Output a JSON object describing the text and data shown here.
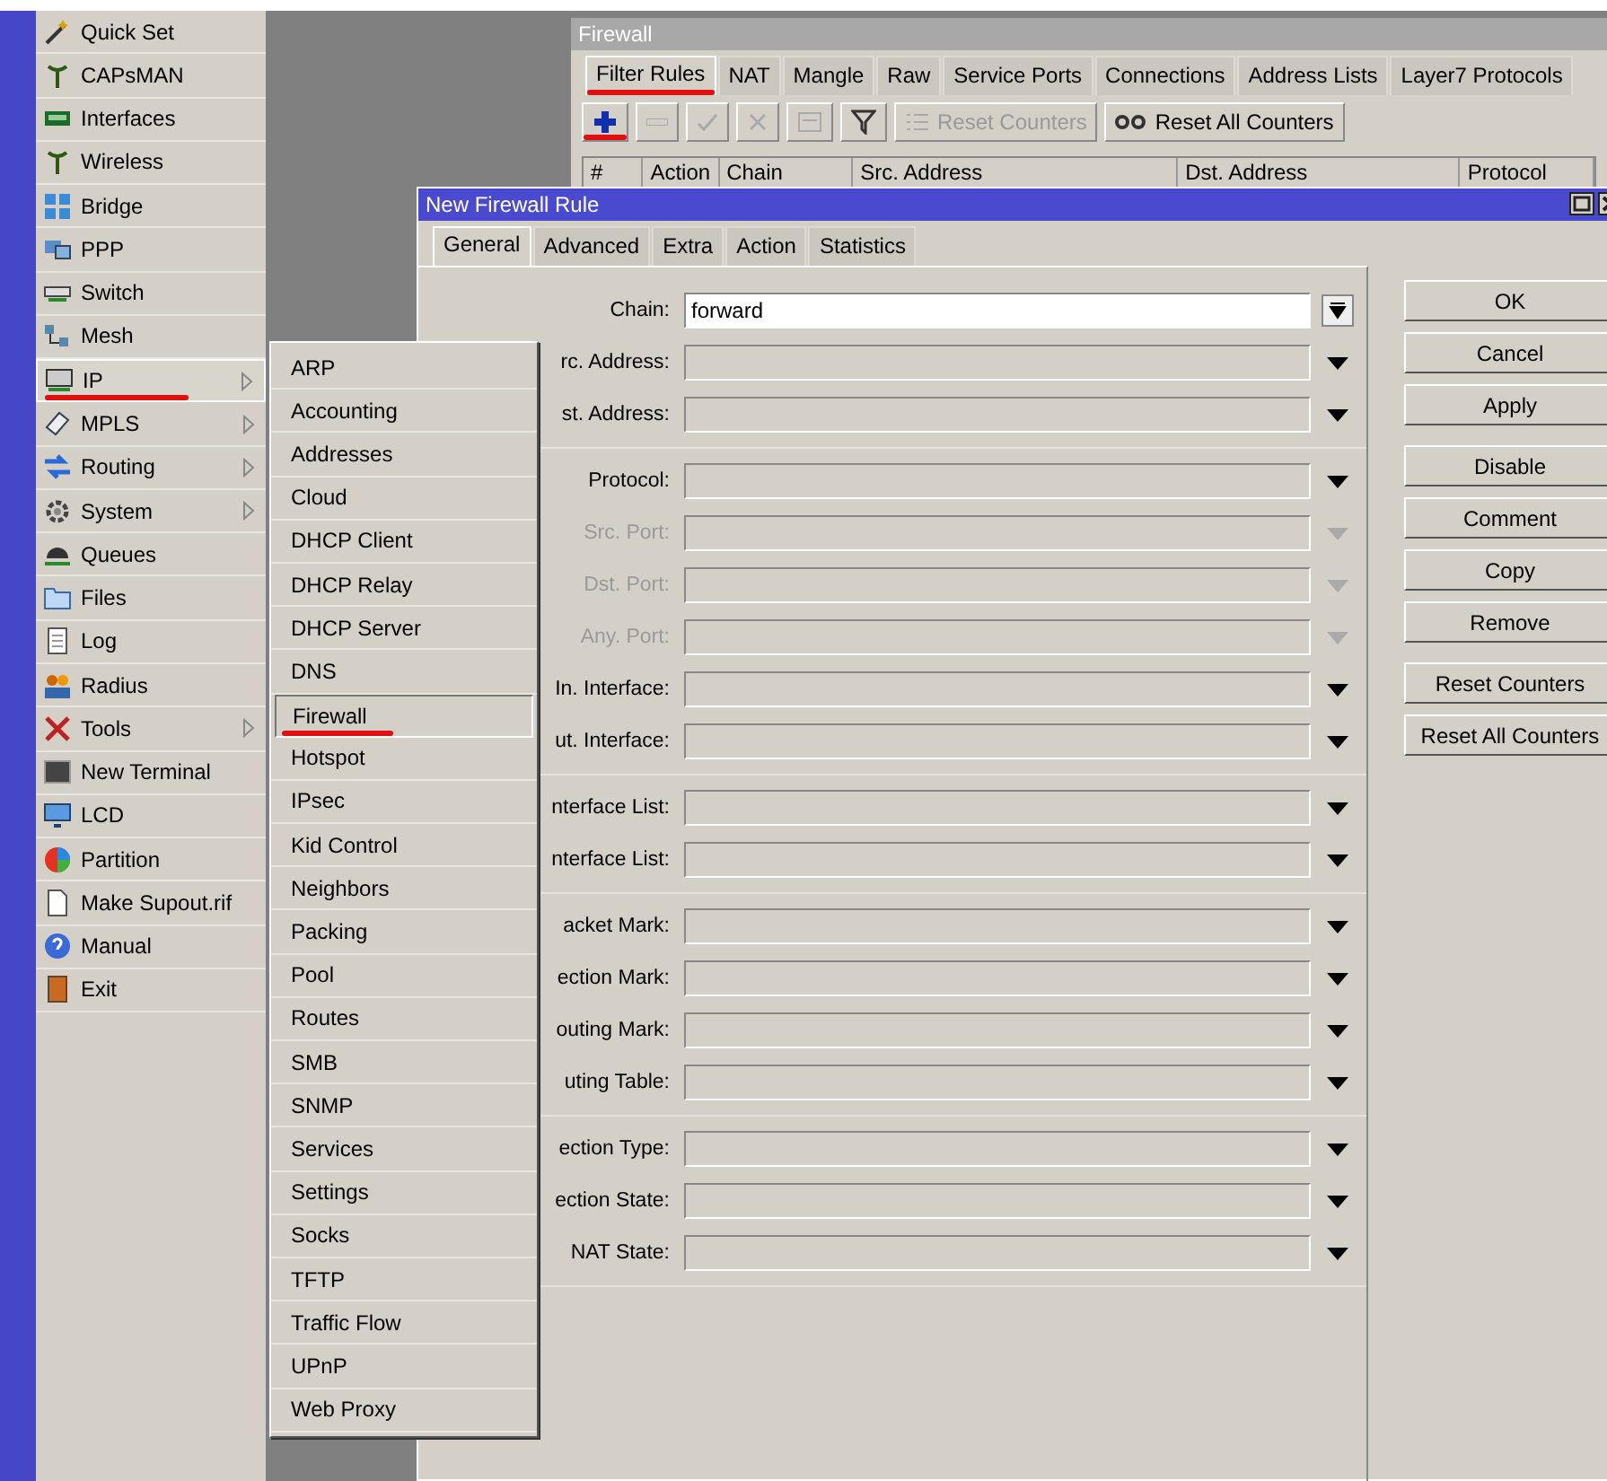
{
  "sidebar": {
    "items": [
      {
        "label": "Quick Set",
        "selected": false,
        "has_submenu": false,
        "underlined": false
      },
      {
        "label": "CAPsMAN",
        "selected": false,
        "has_submenu": false,
        "underlined": false
      },
      {
        "label": "Interfaces",
        "selected": false,
        "has_submenu": false,
        "underlined": false
      },
      {
        "label": "Wireless",
        "selected": false,
        "has_submenu": false,
        "underlined": false
      },
      {
        "label": "Bridge",
        "selected": false,
        "has_submenu": false,
        "underlined": false
      },
      {
        "label": "PPP",
        "selected": false,
        "has_submenu": false,
        "underlined": false
      },
      {
        "label": "Switch",
        "selected": false,
        "has_submenu": false,
        "underlined": false
      },
      {
        "label": "Mesh",
        "selected": false,
        "has_submenu": false,
        "underlined": false
      },
      {
        "label": "IP",
        "selected": true,
        "has_submenu": true,
        "underlined": true
      },
      {
        "label": "MPLS",
        "selected": false,
        "has_submenu": true,
        "underlined": false
      },
      {
        "label": "Routing",
        "selected": false,
        "has_submenu": true,
        "underlined": false
      },
      {
        "label": "System",
        "selected": false,
        "has_submenu": true,
        "underlined": false
      },
      {
        "label": "Queues",
        "selected": false,
        "has_submenu": false,
        "underlined": false
      },
      {
        "label": "Files",
        "selected": false,
        "has_submenu": false,
        "underlined": false
      },
      {
        "label": "Log",
        "selected": false,
        "has_submenu": false,
        "underlined": false
      },
      {
        "label": "Radius",
        "selected": false,
        "has_submenu": false,
        "underlined": false
      },
      {
        "label": "Tools",
        "selected": false,
        "has_submenu": true,
        "underlined": false
      },
      {
        "label": "New Terminal",
        "selected": false,
        "has_submenu": false,
        "underlined": false
      },
      {
        "label": "LCD",
        "selected": false,
        "has_submenu": false,
        "underlined": false
      },
      {
        "label": "Partition",
        "selected": false,
        "has_submenu": false,
        "underlined": false
      },
      {
        "label": "Make Supout.rif",
        "selected": false,
        "has_submenu": false,
        "underlined": false
      },
      {
        "label": "Manual",
        "selected": false,
        "has_submenu": false,
        "underlined": false
      },
      {
        "label": "Exit",
        "selected": false,
        "has_submenu": false,
        "underlined": false
      }
    ]
  },
  "ip_submenu": {
    "items": [
      {
        "label": "ARP",
        "selected": false,
        "underlined": false
      },
      {
        "label": "Accounting",
        "selected": false,
        "underlined": false
      },
      {
        "label": "Addresses",
        "selected": false,
        "underlined": false
      },
      {
        "label": "Cloud",
        "selected": false,
        "underlined": false
      },
      {
        "label": "DHCP Client",
        "selected": false,
        "underlined": false
      },
      {
        "label": "DHCP Relay",
        "selected": false,
        "underlined": false
      },
      {
        "label": "DHCP Server",
        "selected": false,
        "underlined": false
      },
      {
        "label": "DNS",
        "selected": false,
        "underlined": false
      },
      {
        "label": "Firewall",
        "selected": true,
        "underlined": true
      },
      {
        "label": "Hotspot",
        "selected": false,
        "underlined": false
      },
      {
        "label": "IPsec",
        "selected": false,
        "underlined": false
      },
      {
        "label": "Kid Control",
        "selected": false,
        "underlined": false
      },
      {
        "label": "Neighbors",
        "selected": false,
        "underlined": false
      },
      {
        "label": "Packing",
        "selected": false,
        "underlined": false
      },
      {
        "label": "Pool",
        "selected": false,
        "underlined": false
      },
      {
        "label": "Routes",
        "selected": false,
        "underlined": false
      },
      {
        "label": "SMB",
        "selected": false,
        "underlined": false
      },
      {
        "label": "SNMP",
        "selected": false,
        "underlined": false
      },
      {
        "label": "Services",
        "selected": false,
        "underlined": false
      },
      {
        "label": "Settings",
        "selected": false,
        "underlined": false
      },
      {
        "label": "Socks",
        "selected": false,
        "underlined": false
      },
      {
        "label": "TFTP",
        "selected": false,
        "underlined": false
      },
      {
        "label": "Traffic Flow",
        "selected": false,
        "underlined": false
      },
      {
        "label": "UPnP",
        "selected": false,
        "underlined": false
      },
      {
        "label": "Web Proxy",
        "selected": false,
        "underlined": false
      }
    ]
  },
  "firewall_window": {
    "title": "Firewall",
    "tabs": [
      {
        "label": "Filter Rules",
        "selected": true,
        "underlined": true
      },
      {
        "label": "NAT",
        "selected": false,
        "underlined": false
      },
      {
        "label": "Mangle",
        "selected": false,
        "underlined": false
      },
      {
        "label": "Raw",
        "selected": false,
        "underlined": false
      },
      {
        "label": "Service Ports",
        "selected": false,
        "underlined": false
      },
      {
        "label": "Connections",
        "selected": false,
        "underlined": false
      },
      {
        "label": "Address Lists",
        "selected": false,
        "underlined": false
      },
      {
        "label": "Layer7 Protocols",
        "selected": false,
        "underlined": false
      }
    ],
    "toolbar": [
      {
        "kind": "add",
        "disabled": false,
        "underlined": true
      },
      {
        "kind": "remove",
        "disabled": true,
        "underlined": false
      },
      {
        "kind": "enable",
        "disabled": true,
        "underlined": false
      },
      {
        "kind": "disable",
        "disabled": true,
        "underlined": false
      },
      {
        "kind": "comment",
        "disabled": true,
        "underlined": false
      },
      {
        "kind": "filter",
        "disabled": false,
        "underlined": false
      },
      {
        "kind": "reset",
        "label": "Reset Counters",
        "disabled": true,
        "underlined": false
      },
      {
        "kind": "reset_all",
        "label": "Reset All Counters",
        "disabled": false,
        "underlined": false
      }
    ],
    "table": {
      "columns": [
        "#",
        "Action",
        "Chain",
        "Src. Address",
        "Dst. Address",
        "Protocol"
      ]
    }
  },
  "dialog": {
    "title": "New Firewall Rule",
    "tabs": [
      {
        "label": "General",
        "selected": true
      },
      {
        "label": "Advanced",
        "selected": false
      },
      {
        "label": "Extra",
        "selected": false
      },
      {
        "label": "Action",
        "selected": false
      },
      {
        "label": "Statistics",
        "selected": false
      }
    ],
    "field_groups": [
      [
        {
          "kind": "combo",
          "label": "Chain:",
          "value": "forward",
          "disabled": false
        },
        {
          "kind": "select",
          "label": "rc. Address:",
          "disabled": false
        },
        {
          "kind": "select",
          "label": "st. Address:",
          "disabled": false
        }
      ],
      [
        {
          "kind": "select",
          "label": "Protocol:",
          "disabled": false
        },
        {
          "kind": "select",
          "label": "Src. Port:",
          "disabled": true
        },
        {
          "kind": "select",
          "label": "Dst. Port:",
          "disabled": true
        },
        {
          "kind": "select",
          "label": "Any. Port:",
          "disabled": true
        },
        {
          "kind": "select",
          "label": "In. Interface:",
          "disabled": false
        },
        {
          "kind": "select",
          "label": "ut. Interface:",
          "disabled": false
        }
      ],
      [
        {
          "kind": "select",
          "label": "nterface List:",
          "disabled": false
        },
        {
          "kind": "select",
          "label": "nterface List:",
          "disabled": false
        }
      ],
      [
        {
          "kind": "select",
          "label": "acket Mark:",
          "disabled": false
        },
        {
          "kind": "select",
          "label": "ection Mark:",
          "disabled": false
        },
        {
          "kind": "select",
          "label": "outing Mark:",
          "disabled": false
        },
        {
          "kind": "select",
          "label": "uting Table:",
          "disabled": false
        }
      ],
      [
        {
          "kind": "select",
          "label": "ection Type:",
          "disabled": false
        },
        {
          "kind": "select",
          "label": "ection State:",
          "disabled": false
        },
        {
          "kind": "select",
          "label": "NAT State:",
          "disabled": false
        }
      ]
    ],
    "buttons": [
      "OK",
      "Cancel",
      "Apply",
      "Disable",
      "Comment",
      "Copy",
      "Remove",
      "Reset Counters",
      "Reset All Counters"
    ]
  }
}
